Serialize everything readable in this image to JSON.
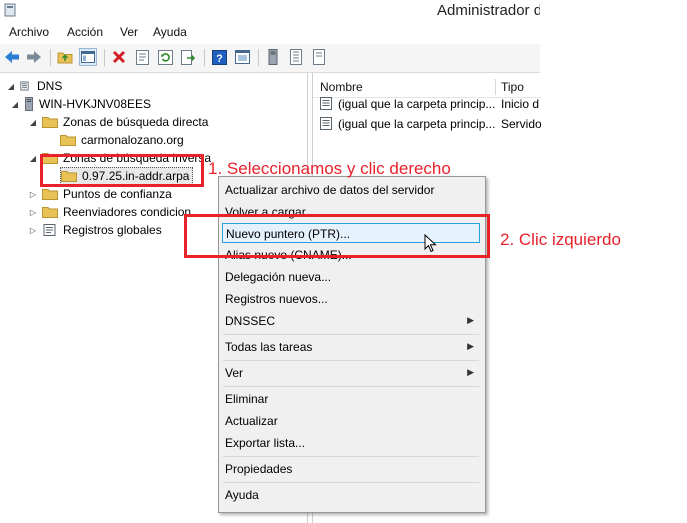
{
  "window": {
    "title": "Administrador d"
  },
  "menubar": {
    "items": [
      "Archivo",
      "Acción",
      "Ver",
      "Ayuda"
    ]
  },
  "toolbar": {
    "buttons": [
      "back-arrow-icon",
      "forward-arrow-icon",
      "up-folder-icon",
      "console-tree-icon",
      "delete-icon",
      "properties-icon",
      "refresh-icon",
      "export-icon",
      "help-icon",
      "view-icon",
      "server-icon",
      "server-list-icon",
      "file-icon"
    ]
  },
  "tree": {
    "root": "DNS",
    "server": "WIN-HVKJNV08EES",
    "forward_zones": "Zonas de búsqueda directa",
    "forward_zone_item": "carmonalozano.org",
    "reverse_zones": "Zonas de búsqueda inversa",
    "reverse_zone_item": "0.97.25.in-addr.arpa",
    "trust_points": "Puntos de confianza",
    "forwarders": "Reenviadores condicion",
    "global_logs": "Registros globales"
  },
  "list": {
    "columns": [
      "Nombre",
      "Tipo"
    ],
    "rows": [
      {
        "name": "(igual que la carpeta princip...",
        "type": "Inicio d"
      },
      {
        "name": "(igual que la carpeta princip...",
        "type": "Servidor"
      }
    ]
  },
  "context_menu": {
    "items": [
      "Actualizar archivo de datos del servidor",
      "Volver a cargar",
      "Nuevo puntero (PTR)...",
      "Alias nuevo (CNAME)...",
      "Delegación nueva...",
      "Registros nuevos...",
      "DNSSEC",
      "Todas las tareas",
      "Ver",
      "Eliminar",
      "Actualizar",
      "Exportar lista...",
      "Propiedades",
      "Ayuda"
    ]
  },
  "annotations": {
    "step1": "1. Seleccionamos y clic derecho",
    "step2": "2. Clic izquierdo"
  },
  "colors": {
    "annotation": "#e8212a",
    "highlight_border": "#26a0da",
    "highlight_fill": "#e5f1fb",
    "folder": "#e8c257"
  }
}
